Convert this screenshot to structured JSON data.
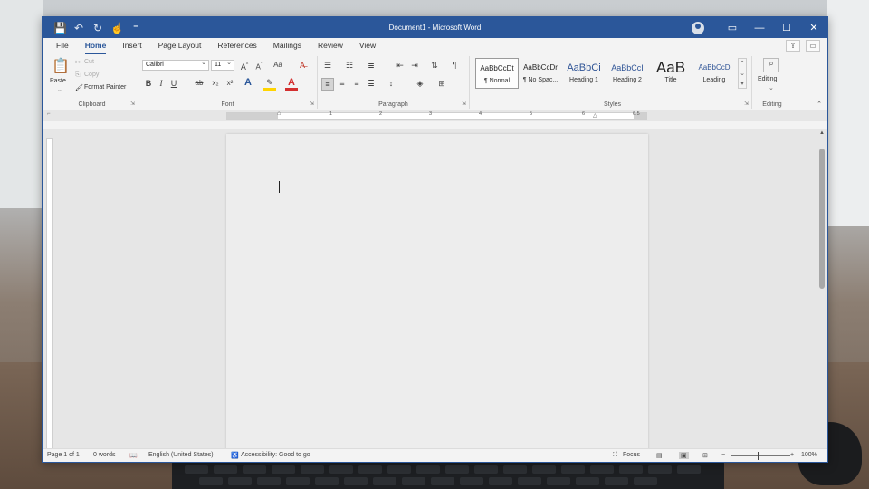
{
  "window": {
    "title": "Document1 - Microsoft Word"
  },
  "qat": {
    "save": "💾",
    "undo": "↶",
    "redo": "↻",
    "touch": "☝",
    "more": "⁼"
  },
  "title_controls": {
    "ribbon_display": "▭",
    "minimize": "—",
    "maximize": "☐",
    "close": "✕"
  },
  "tabs": [
    "File",
    "Home",
    "Insert",
    "Page Layout",
    "References",
    "Mailings",
    "Review",
    "View"
  ],
  "active_tab": "Home",
  "clipboard": {
    "paste": "Paste",
    "cut": "Cut",
    "copy": "Copy",
    "format_painter": "Format Painter",
    "label": "Clipboard"
  },
  "font": {
    "name": "Calibri",
    "size": "11",
    "bold": "B",
    "italic": "I",
    "underline": "U",
    "strike": "ab",
    "sub": "x₂",
    "sup": "x²",
    "effects": "A",
    "highlight": "✎",
    "color": "A",
    "grow": "A^",
    "shrink": "Aˇ",
    "case": "Aa",
    "clear": "A⌫",
    "label": "Font"
  },
  "paragraph": {
    "label": "Paragraph"
  },
  "styles": {
    "items": [
      {
        "preview": "AaBbCcDt",
        "name": "¶ Normal"
      },
      {
        "preview": "AaBbCcDr",
        "name": "¶ No Spac..."
      },
      {
        "preview": "AaBbCi",
        "name": "Heading 1"
      },
      {
        "preview": "AaBbCcI",
        "name": "Heading 2"
      },
      {
        "preview": "AaB",
        "name": "Title"
      },
      {
        "preview": "AaBbCcD",
        "name": "Leading"
      }
    ],
    "label": "Styles"
  },
  "editing": {
    "button": "Editing",
    "label": "Editing"
  },
  "ruler": {
    "numbers": [
      "1",
      "2",
      "3",
      "4",
      "5",
      "6",
      "6.5"
    ]
  },
  "status": {
    "page": "Page 1 of 1",
    "words": "0 words",
    "language": "English (United States)",
    "accessibility": "Accessibility: Good to go",
    "focus": "Focus",
    "zoom": "100%"
  },
  "colors": {
    "accent": "#2b579a",
    "highlight": "#ffd400",
    "font_color": "#d32f2f"
  }
}
